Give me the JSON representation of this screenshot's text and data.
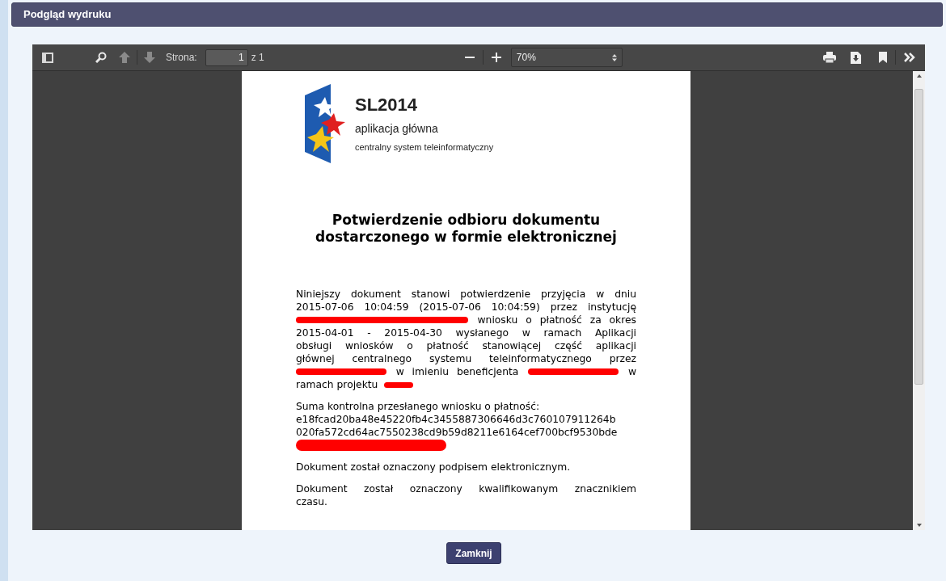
{
  "dialog": {
    "title": "Podgląd wydruku"
  },
  "toolbar": {
    "page_label": "Strona:",
    "page_value": "1",
    "page_count": "z 1",
    "zoom": "70%"
  },
  "document": {
    "logo": {
      "name": "SL2014",
      "subtitle": "aplikacja główna",
      "tagline": "centralny system teleinformatyczny"
    },
    "title": [
      "Potwierdzenie odbioru dokumentu",
      "dostarczonego w formie elektronicznej"
    ],
    "paragraphs": [
      {
        "lines": [
          {
            "justified": true,
            "parts": [
              {
                "kind": "text",
                "text": "Niniejszy dokument stanowi potwierdzenie przyjęcia w dniu"
              }
            ]
          },
          {
            "justified": true,
            "parts": [
              {
                "kind": "text",
                "text": "2015-07-06 10:04:59 (2015-07-06 10:04:59) przez instytucję"
              }
            ]
          },
          {
            "justified": true,
            "parts": [
              {
                "kind": "redaction"
              },
              {
                "kind": "text",
                "text": "wniosku o płatność za okres"
              }
            ]
          },
          {
            "justified": true,
            "parts": [
              {
                "kind": "text",
                "text": "2015-04-01 - 2015-04-30 wysłanego w ramach Aplikacji"
              }
            ]
          },
          {
            "justified": true,
            "parts": [
              {
                "kind": "text",
                "text": "obsługi wniosków o płatność stanowiącej część aplikacji"
              }
            ]
          },
          {
            "justified": true,
            "parts": [
              {
                "kind": "text",
                "text": "głównej centralnego systemu teleinformatycznego przez"
              }
            ]
          },
          {
            "justified": true,
            "parts": [
              {
                "kind": "redaction"
              },
              {
                "kind": "text",
                "text": "w imieniu beneficjenta"
              },
              {
                "kind": "redaction"
              },
              {
                "kind": "text",
                "text": "w"
              }
            ]
          },
          {
            "justified": false,
            "parts": [
              {
                "kind": "text",
                "text": "ramach projektu"
              },
              {
                "kind": "redaction"
              }
            ]
          }
        ]
      },
      {
        "lines": [
          {
            "justified": false,
            "parts": [
              {
                "kind": "text",
                "text": "Suma kontrolna przesłanego wniosku o płatność:"
              }
            ]
          },
          {
            "parts": [
              {
                "kind": "text",
                "text": "e18fcad20ba48e45220fb4c3455887306646d3c760107911264b"
              }
            ]
          },
          {
            "parts": [
              {
                "kind": "text",
                "text": "020fa572cd64ac7550238cd9b59d8211e6164cef700bcf9530bde"
              }
            ]
          },
          {
            "parts": [
              {
                "kind": "redaction"
              }
            ]
          }
        ]
      },
      {
        "lines": [
          {
            "justified": false,
            "parts": [
              {
                "kind": "text",
                "text": "Dokument został oznaczony podpisem elektronicznym."
              }
            ]
          }
        ]
      },
      {
        "lines": [
          {
            "justified": true,
            "parts": [
              {
                "kind": "text",
                "text": "Dokument został oznaczony kwalifikowanym znacznikiem"
              }
            ]
          },
          {
            "parts": [
              {
                "kind": "text",
                "text": "czasu."
              }
            ]
          }
        ]
      }
    ]
  },
  "buttons": [
    {
      "label": "Zamknij"
    }
  ]
}
